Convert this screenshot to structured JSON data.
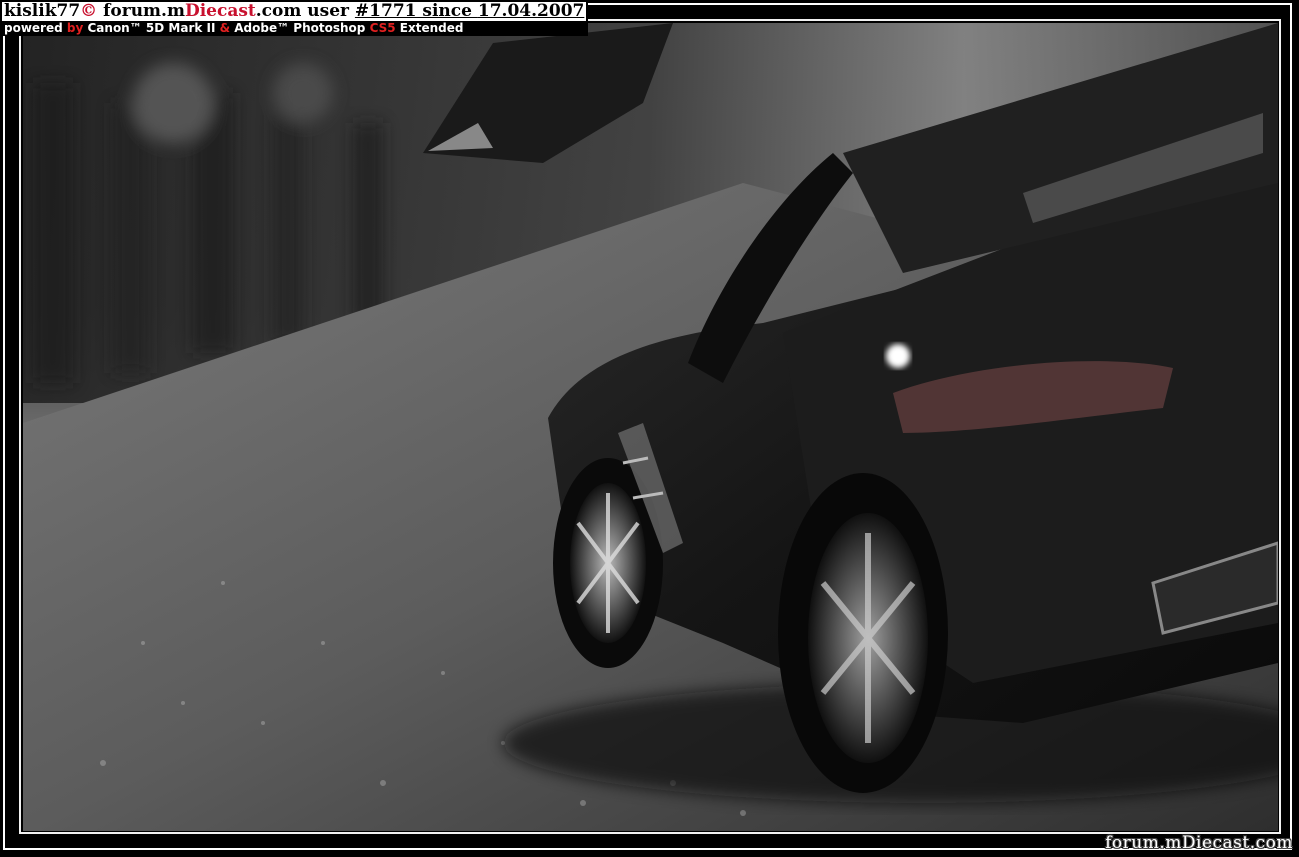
{
  "watermark": {
    "user": "kislik77",
    "copyright_symbol": "©",
    "forum_prefix": " forum.m",
    "forum_brand": "Diecast",
    "forum_suffix": ".com",
    "user_label": " user ",
    "user_number": "#1771",
    "since_label": " since ",
    "since_date": "17.04.2007",
    "powered_prefix": "powered ",
    "powered_by": "by",
    "camera_brand": " Canon™",
    "camera_model": " 5D Mark II ",
    "ampersand": "&",
    "software_brand": " Adobe™ Photoshop ",
    "software_version": "CS5",
    "software_edition": " Extended"
  },
  "logo": {
    "text": "forum.mDiecast.com"
  },
  "photo": {
    "subject": "black gull-wing sports car model on asphalt",
    "palette": {
      "asphalt": "#5a5a5a",
      "background": "#2e2e2e",
      "car_body": "#141414",
      "highlight": "#ffffff"
    }
  }
}
